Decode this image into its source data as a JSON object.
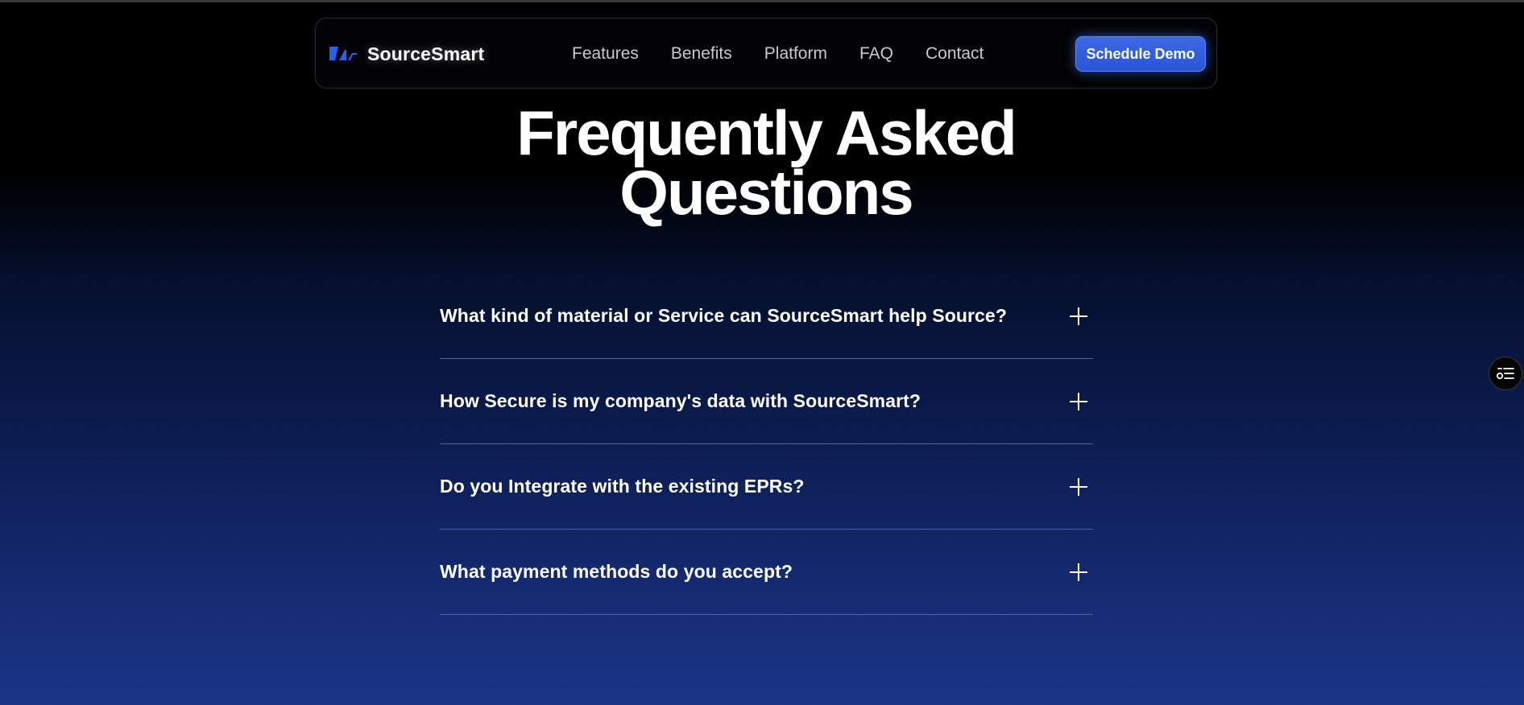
{
  "brand": {
    "name": "SourceSmart",
    "logo_icon": "sourcesmart-logo-icon",
    "logo_color": "#2563eb"
  },
  "nav": {
    "links": [
      {
        "label": "Features"
      },
      {
        "label": "Benefits"
      },
      {
        "label": "Platform"
      },
      {
        "label": "FAQ"
      },
      {
        "label": "Contact"
      }
    ],
    "cta_label": "Schedule Demo"
  },
  "faq": {
    "title_line1": "Frequently Asked",
    "title_line2": "Questions",
    "items": [
      {
        "question": "What kind of material or Service can SourceSmart help Source?",
        "expanded": false
      },
      {
        "question": "How Secure is my company's data with SourceSmart?",
        "expanded": false
      },
      {
        "question": "Do you Integrate with the existing EPRs?",
        "expanded": false
      },
      {
        "question": "What payment methods do you accept?",
        "expanded": false
      }
    ]
  },
  "widget": {
    "icon": "settings-list-icon"
  },
  "colors": {
    "accent": "#2f5fe0",
    "background_top": "#000000",
    "background_bottom": "#1b3588"
  }
}
